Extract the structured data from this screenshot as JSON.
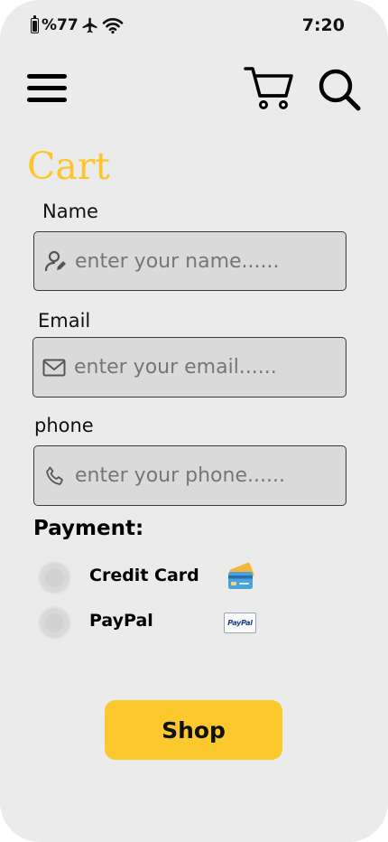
{
  "status_bar": {
    "battery_text": "%77",
    "time": "7:20",
    "icons": [
      "battery-icon",
      "airplane-icon",
      "wifi-icon"
    ]
  },
  "header": {
    "icons": [
      "menu-icon",
      "cart-icon",
      "search-icon"
    ]
  },
  "page": {
    "title": "Cart"
  },
  "form": {
    "name": {
      "label": "Name",
      "placeholder": "enter your name......",
      "value": "",
      "icon": "user-icon"
    },
    "email": {
      "label": "Email",
      "placeholder": "enter your email......",
      "value": "",
      "icon": "mail-icon"
    },
    "phone": {
      "label": "phone",
      "placeholder": "enter your phone......",
      "value": "",
      "icon": "phone-icon"
    }
  },
  "payment": {
    "title": "Payment:",
    "options": [
      {
        "label": "Credit Card",
        "icon": "credit-card-icon",
        "selected": false
      },
      {
        "label": "PayPal",
        "icon": "paypal-icon",
        "icon_text": "PayPal",
        "selected": false
      }
    ]
  },
  "actions": {
    "shop_label": "Shop"
  },
  "colors": {
    "background": "#ebebeb",
    "accent": "#fcc629",
    "button": "#fbc92e",
    "field": "#dadada"
  }
}
